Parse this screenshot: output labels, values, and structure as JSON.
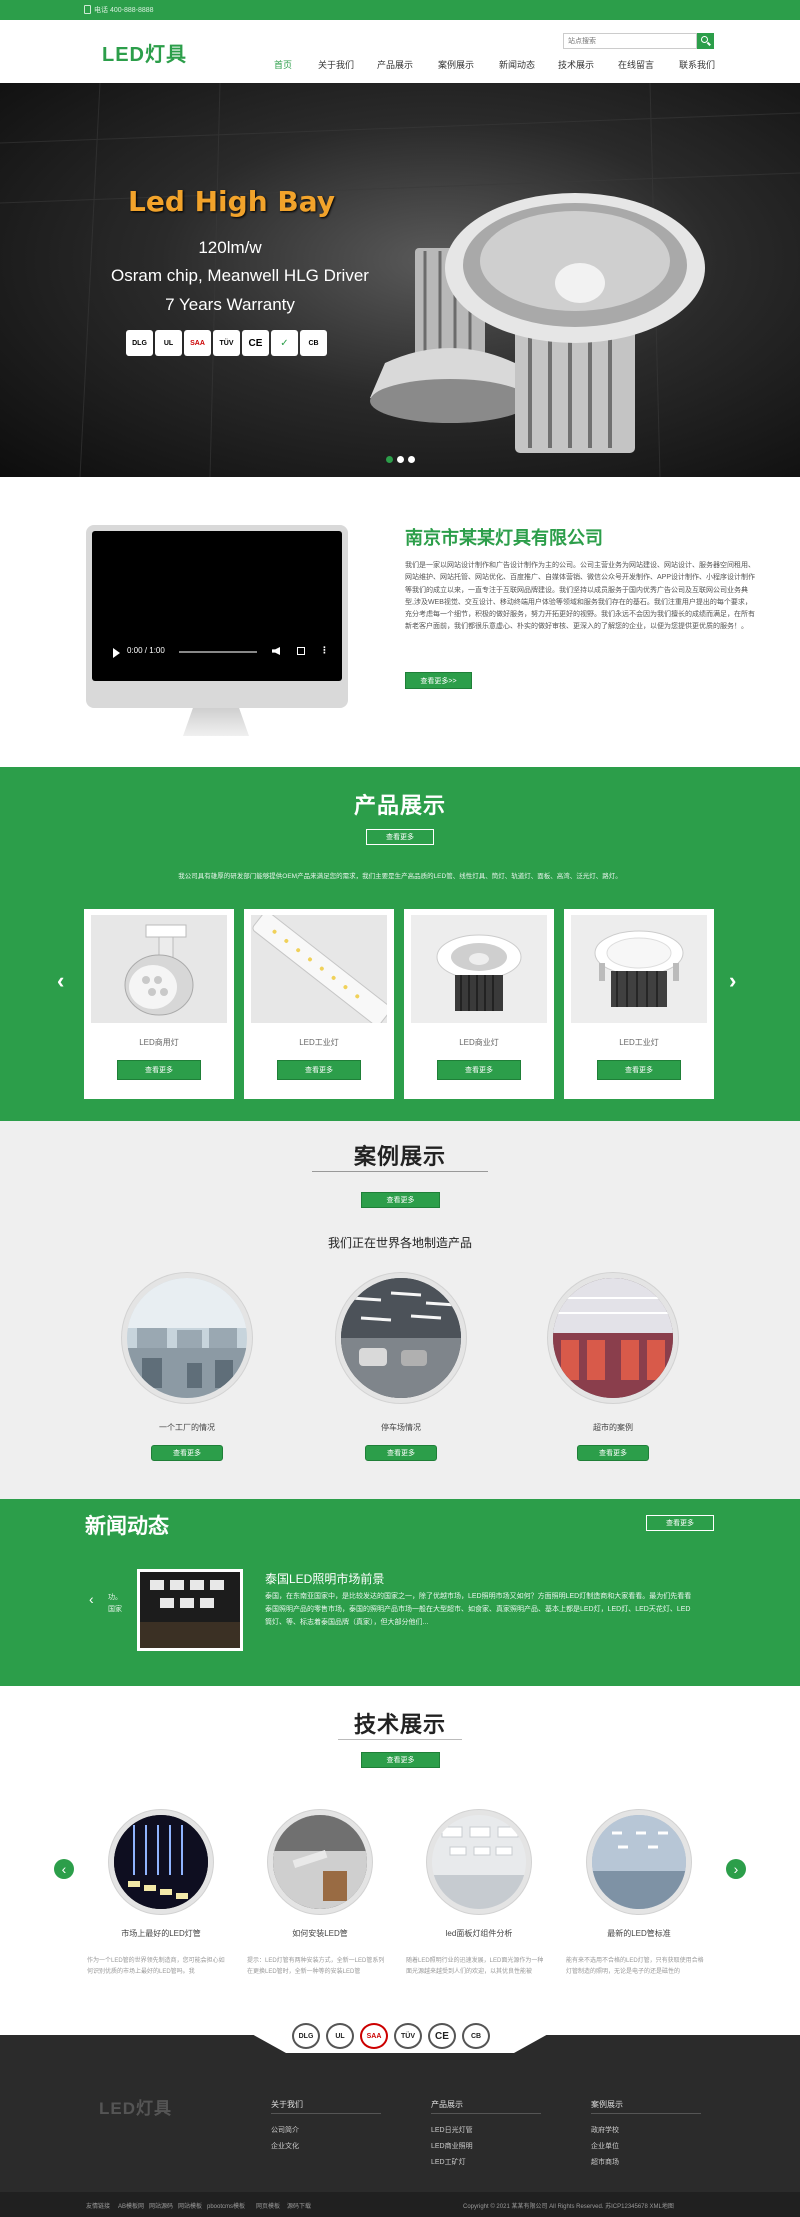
{
  "topbar": {
    "phone": "电话 400-888-8888"
  },
  "header": {
    "logo": "LED灯具",
    "search_placeholder": "站点搜索",
    "nav": [
      "首页",
      "关于我们",
      "产品展示",
      "案例展示",
      "新闻动态",
      "技术展示",
      "在线留言",
      "联系我们"
    ]
  },
  "hero": {
    "title": "Led High Bay",
    "line1": "120lm/w",
    "line2": "Osram chip, Meanwell HLG Driver",
    "line3": "7 Years Warranty",
    "badges": [
      "DLG",
      "UL",
      "SAA",
      "TÜV",
      "CE",
      "✓",
      "CB"
    ],
    "slides": 3
  },
  "about": {
    "video_time": "0:00 / 1:00",
    "company": "南京市某某灯具有限公司",
    "text": "我们是一家以网站设计制作和广告设计制作为主的公司。公司主营业务为网站建设、网站设计、服务器空间租用、网站维护、网站托管、网站优化、百度推广、自媒体营销、微信公众号开发制作、APP设计制作、小程序设计制作等我们的成立以来，一直专注于互联网品牌建设。我们坚持以成员服务于国内优秀广告公司及互联网公司业务典型,涉及WEB视觉、交互设计、移动终端用户体验等领域和服务我们存在的基石。我们注重用户提出的每个要求，充分考虑每一个细节，积极的做好服务，努力开拓更好的视野。我们永远不会因为我们擅长的成绩而满足，在所有新老客户面前，我们都很乐意虚心、朴实的做好审核、更深入的了解您的企业，以便为您提供更优质的服务！。",
    "more": "查看更多>>"
  },
  "products": {
    "title": "产品展示",
    "more": "查看更多",
    "desc": "我公司具有雄厚的研发部门能够提供OEM产品来满足您的需求，我们主要是生产高品质的LED管、线性灯具、筒灯、轨道灯、面板、高湾、泛光灯、路灯。",
    "items": [
      {
        "label": "LED商用灯",
        "btn": "查看更多"
      },
      {
        "label": "LED工业灯",
        "btn": "查看更多"
      },
      {
        "label": "LED商业灯",
        "btn": "查看更多"
      },
      {
        "label": "LED工业灯",
        "btn": "查看更多"
      }
    ]
  },
  "cases": {
    "title": "案例展示",
    "more": "查看更多",
    "subtitle": "我们正在世界各地制造产品",
    "items": [
      {
        "label": "一个工厂的情况",
        "btn": "查看更多"
      },
      {
        "label": "停车场情况",
        "btn": "查看更多"
      },
      {
        "label": "超市的案例",
        "btn": "查看更多"
      }
    ]
  },
  "news": {
    "title": "新闻动态",
    "more": "查看更多",
    "prev_text": "功。\n国家",
    "headline": "泰国LED照明市场前景",
    "body": "泰国，在东南亚国家中，是比较发达的国家之一，除了优越市场，LED照明市场又如何？方面照明LED灯制造商和大家看看。最为们先看看泰国照明产品的零售市场，泰国的照明产品市场一般在大型超市、如食家、真家照明产品、基本上都是LED灯，LED灯、LED天花灯、LED筒灯、等、标志着泰国品牌（真家），但大部分他们..."
  },
  "tech": {
    "title": "技术展示",
    "more": "查看更多",
    "items": [
      {
        "label": "市场上最好的LED灯管",
        "desc": "作为一个LED管的世界领先制造商，您可能会担心如何识别优质的市场上最好的LED管吗。我"
      },
      {
        "label": "如何安装LED管",
        "desc": "提示：LED灯管有两种安装方式，全新一LED管系列在更换LED管时，全新一种等的安装LED管"
      },
      {
        "label": "led面板灯组件分析",
        "desc": "随着LED照明行业的迅速发展，LED面光源作为一种面光源越来越受到人们的欢迎，以其优良性能被"
      },
      {
        "label": "最新的LED管标准",
        "desc": "能有来不选用不合格的LED灯管，只有获取使用合格灯管制造的照明，无论是电子的还是磁性的"
      }
    ]
  },
  "footer": {
    "badges": [
      "DLG",
      "UL",
      "SAA",
      "TÜV",
      "CE",
      "CB"
    ],
    "logo": "LED灯具",
    "cols": [
      {
        "title": "关于我们",
        "links": [
          "公司简介",
          "企业文化"
        ]
      },
      {
        "title": "产品展示",
        "links": [
          "LED日光灯管",
          "LED商业照明",
          "LED工矿灯"
        ]
      },
      {
        "title": "案例展示",
        "links": [
          "政府学校",
          "企业单位",
          "超市商场"
        ]
      }
    ],
    "bottom_links": [
      "友情链接",
      "AB模板网",
      "网站源码",
      "网站模板",
      "pbootcms模板",
      "网页模板",
      "源码下载"
    ],
    "copyright": "Copyright © 2021 某某有限公司 All Rights Reserved. 苏ICP12345678 XML地图"
  },
  "colors": {
    "green": "#2c9e4a",
    "dark": "#2b2b2b"
  }
}
